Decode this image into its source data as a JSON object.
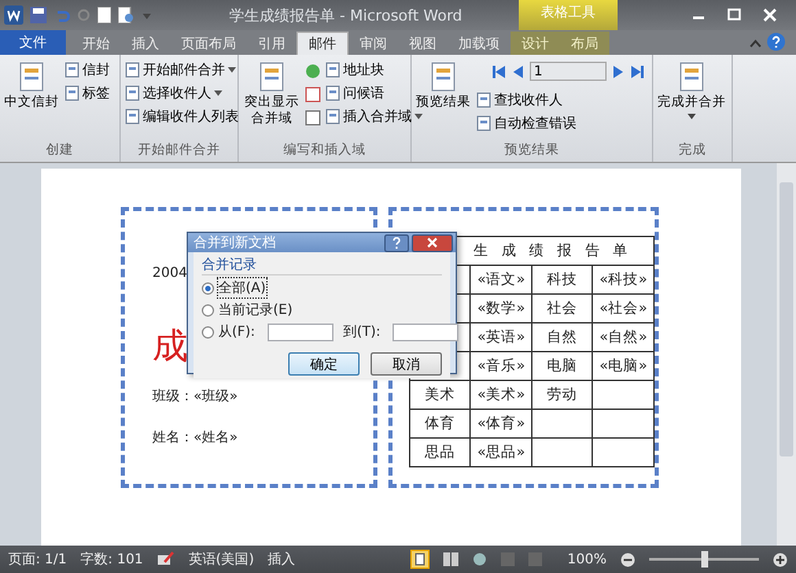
{
  "window": {
    "title": "学生成绩报告单 - Microsoft Word",
    "context_group": "表格工具"
  },
  "tabs": [
    {
      "label": "文件",
      "kind": "file",
      "selected": false
    },
    {
      "label": "开始",
      "kind": "normal",
      "selected": false
    },
    {
      "label": "插入",
      "kind": "normal",
      "selected": false
    },
    {
      "label": "页面布局",
      "kind": "normal",
      "selected": false
    },
    {
      "label": "引用",
      "kind": "normal",
      "selected": false
    },
    {
      "label": "邮件",
      "kind": "normal",
      "selected": true
    },
    {
      "label": "审阅",
      "kind": "normal",
      "selected": false
    },
    {
      "label": "视图",
      "kind": "normal",
      "selected": false
    },
    {
      "label": "加载项",
      "kind": "normal",
      "selected": false
    },
    {
      "label": "设计",
      "kind": "context",
      "selected": false
    },
    {
      "label": "布局",
      "kind": "context",
      "selected": false
    }
  ],
  "ribbon_groups": [
    {
      "label": "创建",
      "items": [
        {
          "label": "中文信封",
          "kind": "large"
        },
        {
          "label": "信封",
          "kind": "small"
        },
        {
          "label": "标签",
          "kind": "small"
        }
      ]
    },
    {
      "label": "开始邮件合并",
      "items": [
        {
          "label": "开始邮件合并",
          "kind": "small",
          "dropdown": true
        },
        {
          "label": "选择收件人",
          "kind": "small",
          "dropdown": true
        },
        {
          "label": "编辑收件人列表",
          "kind": "small",
          "dropdown": false
        }
      ]
    },
    {
      "label": "编写和插入域",
      "items": [
        {
          "label": "突出显示合并域",
          "kind": "large"
        },
        {
          "label": "地址块",
          "kind": "small",
          "dropdown": false
        },
        {
          "label": "问候语",
          "kind": "small",
          "dropdown": false
        },
        {
          "label": "插入合并域",
          "kind": "small",
          "dropdown": true
        },
        {
          "kind": "iconcol"
        }
      ]
    },
    {
      "label": "预览结果",
      "items": [
        {
          "label": "预览结果",
          "kind": "large"
        },
        {
          "value": "1",
          "kind": "nav"
        },
        {
          "label": "查找收件人",
          "kind": "small",
          "dropdown": false
        },
        {
          "label": "自动检查错误",
          "kind": "small",
          "dropdown": false
        }
      ]
    },
    {
      "label": "完成",
      "items": [
        {
          "label": "完成并合并",
          "kind": "large",
          "dropdown": true
        }
      ]
    }
  ],
  "document": {
    "left_box": [
      {
        "text": "2004",
        "kind": "line"
      },
      {
        "text": "成",
        "kind": "title"
      },
      {
        "text": "班级：«班级»",
        "kind": "line"
      },
      {
        "text": "姓名：«姓名»",
        "kind": "line"
      }
    ],
    "table": {
      "heading": "生 成 绩 报 告 单",
      "rows": [
        [
          "",
          "«语文»",
          "科技",
          "«科技»"
        ],
        [
          "",
          "«数学»",
          "社会",
          "«社会»"
        ],
        [
          "",
          "«英语»",
          "自然",
          "«自然»"
        ],
        [
          "",
          "«音乐»",
          "电脑",
          "«电脑»"
        ],
        [
          "美术",
          "«美术»",
          "劳动",
          ""
        ],
        [
          "体育",
          "«体育»",
          "",
          ""
        ],
        [
          "思品",
          "«思品»",
          "",
          ""
        ]
      ]
    }
  },
  "dialog": {
    "title": "合并到新文档",
    "group_label": "合并记录",
    "options": [
      {
        "label": "全部(A)",
        "selected": true,
        "kind": "plain"
      },
      {
        "label": "当前记录(E)",
        "selected": false,
        "kind": "plain"
      },
      {
        "label": "从(F):",
        "selected": false,
        "kind": "range",
        "to_label": "到(T):"
      }
    ],
    "buttons": [
      {
        "label": "确定",
        "default": true
      },
      {
        "label": "取消",
        "default": false
      }
    ]
  },
  "status_bar": {
    "items": [
      "页面: 1/1",
      "字数: 101",
      "英语(美国)",
      "插入"
    ],
    "zoom": "100%",
    "zoom_slider": {
      "level": 0.5
    }
  }
}
